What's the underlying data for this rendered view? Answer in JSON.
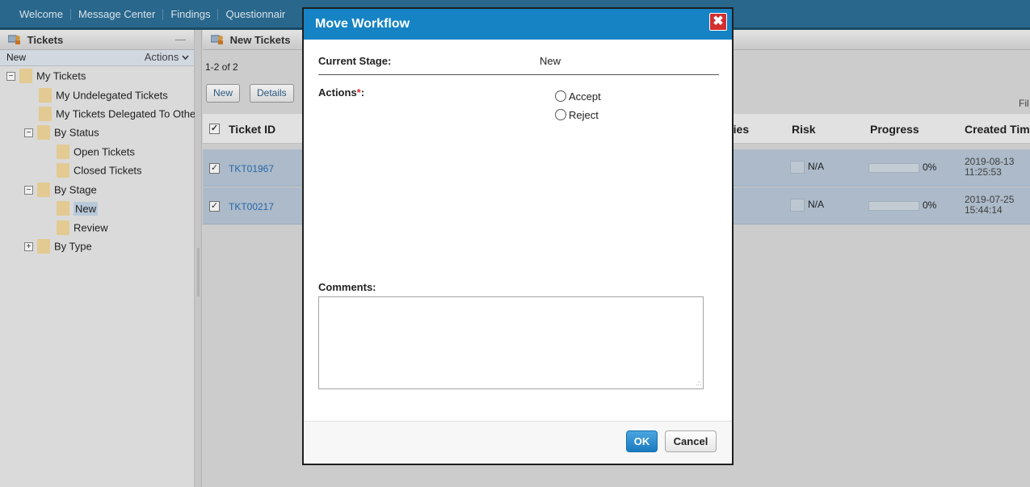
{
  "nav": {
    "tabs": [
      "Welcome",
      "Message Center",
      "Findings",
      "Questionnair"
    ]
  },
  "left_panel": {
    "title": "Tickets",
    "collapse_glyph": "—",
    "view_label": "New",
    "actions_label": "Actions",
    "tree": [
      {
        "label": "My Tickets",
        "toggle": "−"
      },
      {
        "label": "My Undelegated Tickets"
      },
      {
        "label": "My Tickets Delegated To Othe"
      },
      {
        "label": "By Status",
        "toggle": "−"
      },
      {
        "label": "Open Tickets"
      },
      {
        "label": "Closed Tickets"
      },
      {
        "label": "By Stage",
        "toggle": "−"
      },
      {
        "label": "New",
        "selected": true
      },
      {
        "label": "Review"
      },
      {
        "label": "By Type",
        "toggle": "+"
      }
    ]
  },
  "center_panel": {
    "title": "New Tickets",
    "count": "1-2 of 2",
    "buttons": {
      "new": "New",
      "details": "Details"
    },
    "filter_label": "Fil",
    "columns": {
      "ticket_id": "Ticket ID",
      "priorities": "ties",
      "risk": "Risk",
      "progress": "Progress",
      "created": "Created Tim"
    },
    "rows": [
      {
        "ticket_id": "TKT01967",
        "risk": "N/A",
        "progress": "0%",
        "progress_value": 0,
        "created_date": "2019-08-13",
        "created_time": "11:25:53",
        "checked": true
      },
      {
        "ticket_id": "TKT00217",
        "risk": "N/A",
        "progress": "0%",
        "progress_value": 0,
        "created_date": "2019-07-25",
        "created_time": "15:44:14",
        "checked": true
      }
    ]
  },
  "modal": {
    "title": "Move Workflow",
    "close_glyph": "✖",
    "current_stage_label": "Current Stage:",
    "current_stage_value": "New",
    "actions_label": "Actions",
    "required_mark": "*",
    "actions_colon": ":",
    "options": [
      "Accept",
      "Reject"
    ],
    "comments_label": "Comments:",
    "comments_value": "",
    "ok_label": "OK",
    "cancel_label": "Cancel"
  },
  "colors": {
    "accent": "#1683c4",
    "close": "#d32f2f",
    "row_selected": "#b7c6d6",
    "nav": "#2c6e95"
  }
}
